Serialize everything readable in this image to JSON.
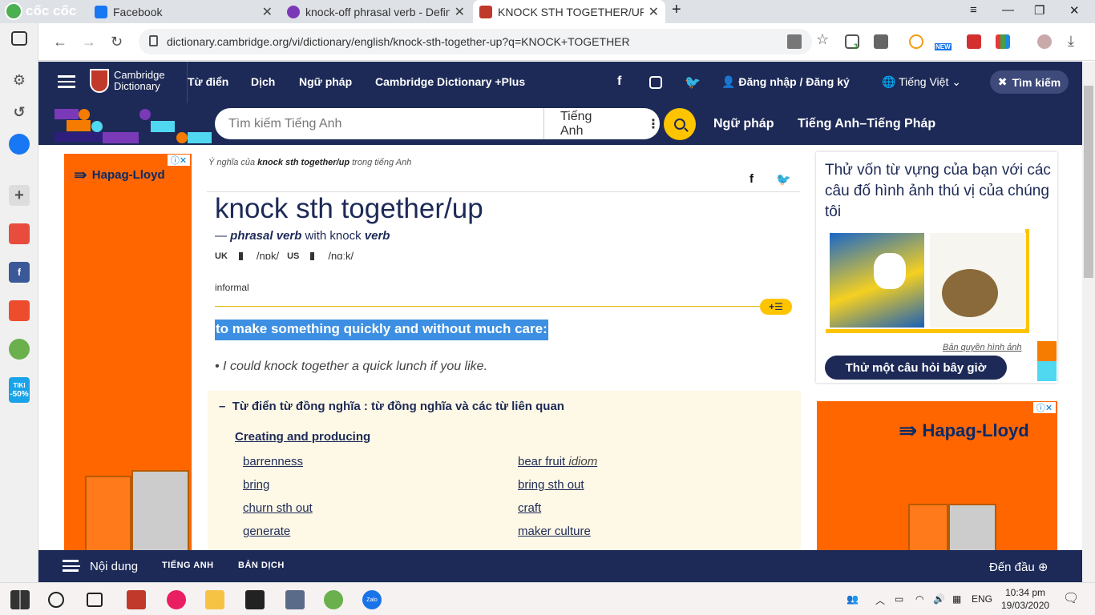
{
  "browser": {
    "brand": "cốc cốc",
    "tabs": [
      {
        "title": "Facebook"
      },
      {
        "title": "knock-off phrasal verb - Defin"
      },
      {
        "title": "KNOCK STH TOGETHER/UP | C"
      }
    ],
    "url": "dictionary.cambridge.org/vi/dictionary/english/knock-sth-together-up?q=KNOCK+TOGETHER",
    "ext_badge": "3",
    "ext_new": "NEW"
  },
  "sidebar_apps": {
    "tiki_label": "TIKI",
    "tiki_badge": "-50%"
  },
  "site": {
    "logo_line1": "Cambridge",
    "logo_line2": "Dictionary",
    "nav": [
      "Từ điển",
      "Dịch",
      "Ngữ pháp",
      "Cambridge Dictionary +Plus"
    ],
    "login": "Đăng nhập / Đăng ký",
    "language": "Tiếng Việt",
    "search_button": "Tìm kiếm",
    "search_placeholder": "Tìm kiếm Tiếng Anh",
    "search_lang": "Tiếng Anh",
    "sub_nav": [
      "Ngữ pháp",
      "Tiếng Anh–Tiếng Pháp"
    ]
  },
  "entry": {
    "breadcrumb_pre": "Ý nghĩa của ",
    "breadcrumb_word": "knock sth together/up",
    "breadcrumb_post": " trong tiếng Anh",
    "headword": "knock sth together/up",
    "pos_dash": "— ",
    "pos": "phrasal verb",
    "pos_with": " with knock ",
    "pos_verb": "verb",
    "uk_label": "UK",
    "uk_ipa": "/nɒk/",
    "us_label": "US",
    "us_ipa": "/nɑːk/",
    "register": "informal",
    "definition": "to make something quickly and without much care:",
    "example": "I could knock together a quick lunch if you like."
  },
  "thesaurus": {
    "heading": "Từ điển từ đồng nghĩa : từ đồng nghĩa và các từ liên quan",
    "subheading": "Creating and producing",
    "left": [
      "barrenness",
      "bring",
      "churn sth out",
      "generate"
    ],
    "right": [
      {
        "word": "bear fruit",
        "tag": "idiom"
      },
      {
        "word": "bring sth out",
        "tag": ""
      },
      {
        "word": "craft",
        "tag": ""
      },
      {
        "word": "maker culture",
        "tag": ""
      }
    ]
  },
  "quiz": {
    "text": "Thử vốn từ vựng của bạn với các câu đố hình ảnh thú vị của chúng tôi",
    "credit": "Bản quyền hình ảnh",
    "button": "Thử một câu hỏi bây giờ"
  },
  "ads": {
    "brand": "Hapag-Lloyd"
  },
  "bottombar": {
    "contents": "Nội dung",
    "english": "TIẾNG ANH",
    "translation": "BẢN DỊCH",
    "top": "Đến đầu"
  },
  "taskbar": {
    "language": "ENG",
    "time": "10:34 pm",
    "date": "19/03/2020",
    "zalo": "Zalo"
  },
  "colors": {
    "brand_navy": "#1d2a57",
    "accent_yellow": "#fec400",
    "ad_orange": "#ff6600",
    "highlight_blue": "#3c8fe2"
  }
}
